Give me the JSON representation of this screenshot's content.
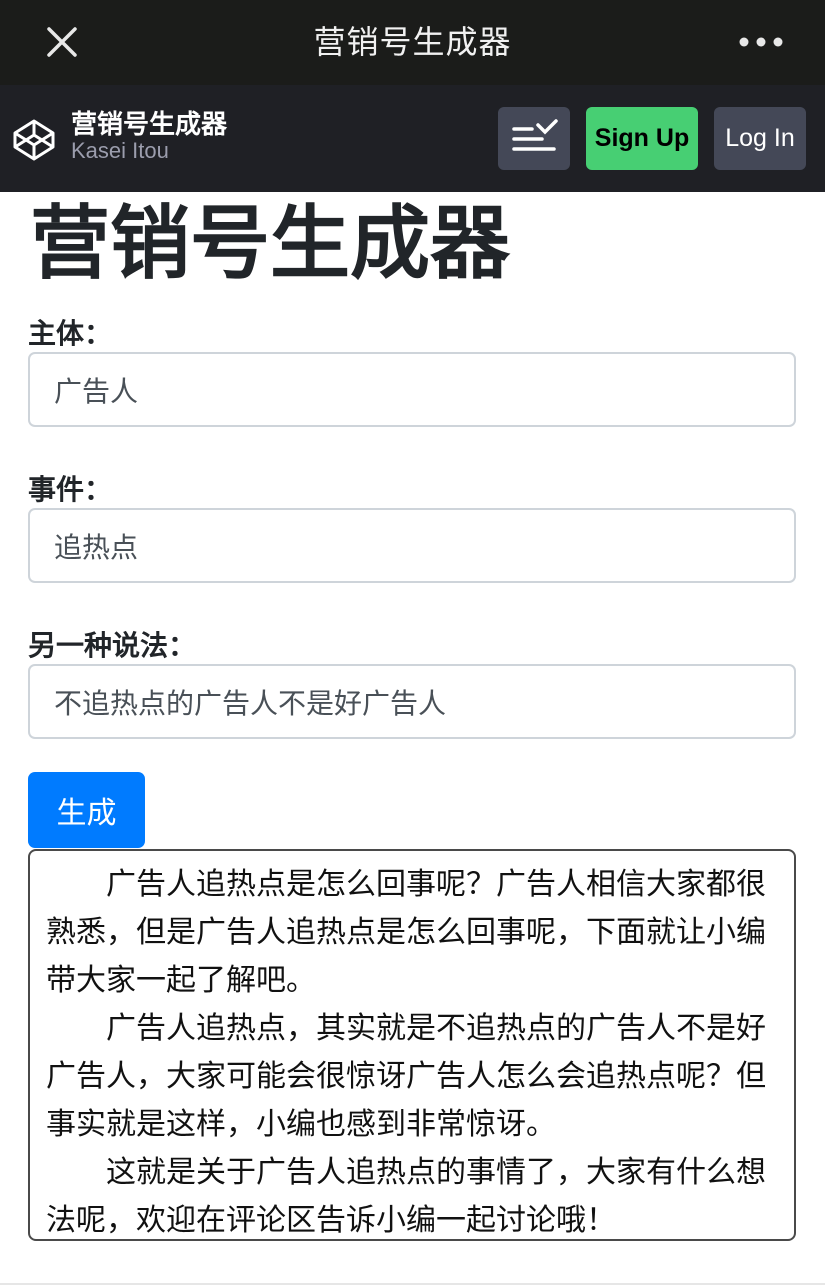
{
  "app_bar": {
    "title": "营销号生成器",
    "close_icon": "close-icon",
    "more_icon": "more-horizontal-icon"
  },
  "pen_header": {
    "title": "营销号生成器",
    "author": "Kasei Itou",
    "view_icon": "layout-toggle-icon",
    "signup_label": "Sign Up",
    "login_label": "Log In",
    "colors": {
      "signup": "#47cf73",
      "button": "#444857",
      "bar": "#1f2025"
    }
  },
  "main": {
    "heading": "营销号生成器",
    "fields": {
      "subject": {
        "label": "主体：",
        "value": "广告人"
      },
      "event": {
        "label": "事件：",
        "value": "追热点"
      },
      "alt": {
        "label": "另一种说法：",
        "value": "不追热点的广告人不是好广告人"
      }
    },
    "generate_label": "生成",
    "output": {
      "p1": "广告人追热点是怎么回事呢？广告人相信大家都很熟悉，但是广告人追热点是怎么回事呢，下面就让小编带大家一起了解吧。",
      "p2": "广告人追热点，其实就是不追热点的广告人不是好广告人，大家可能会很惊讶广告人怎么会追热点呢？但事实就是这样，小编也感到非常惊讶。",
      "p3": "这就是关于广告人追热点的事情了，大家有什么想法呢，欢迎在评论区告诉小编一起讨论哦！"
    },
    "accent_color": "#007bff"
  }
}
